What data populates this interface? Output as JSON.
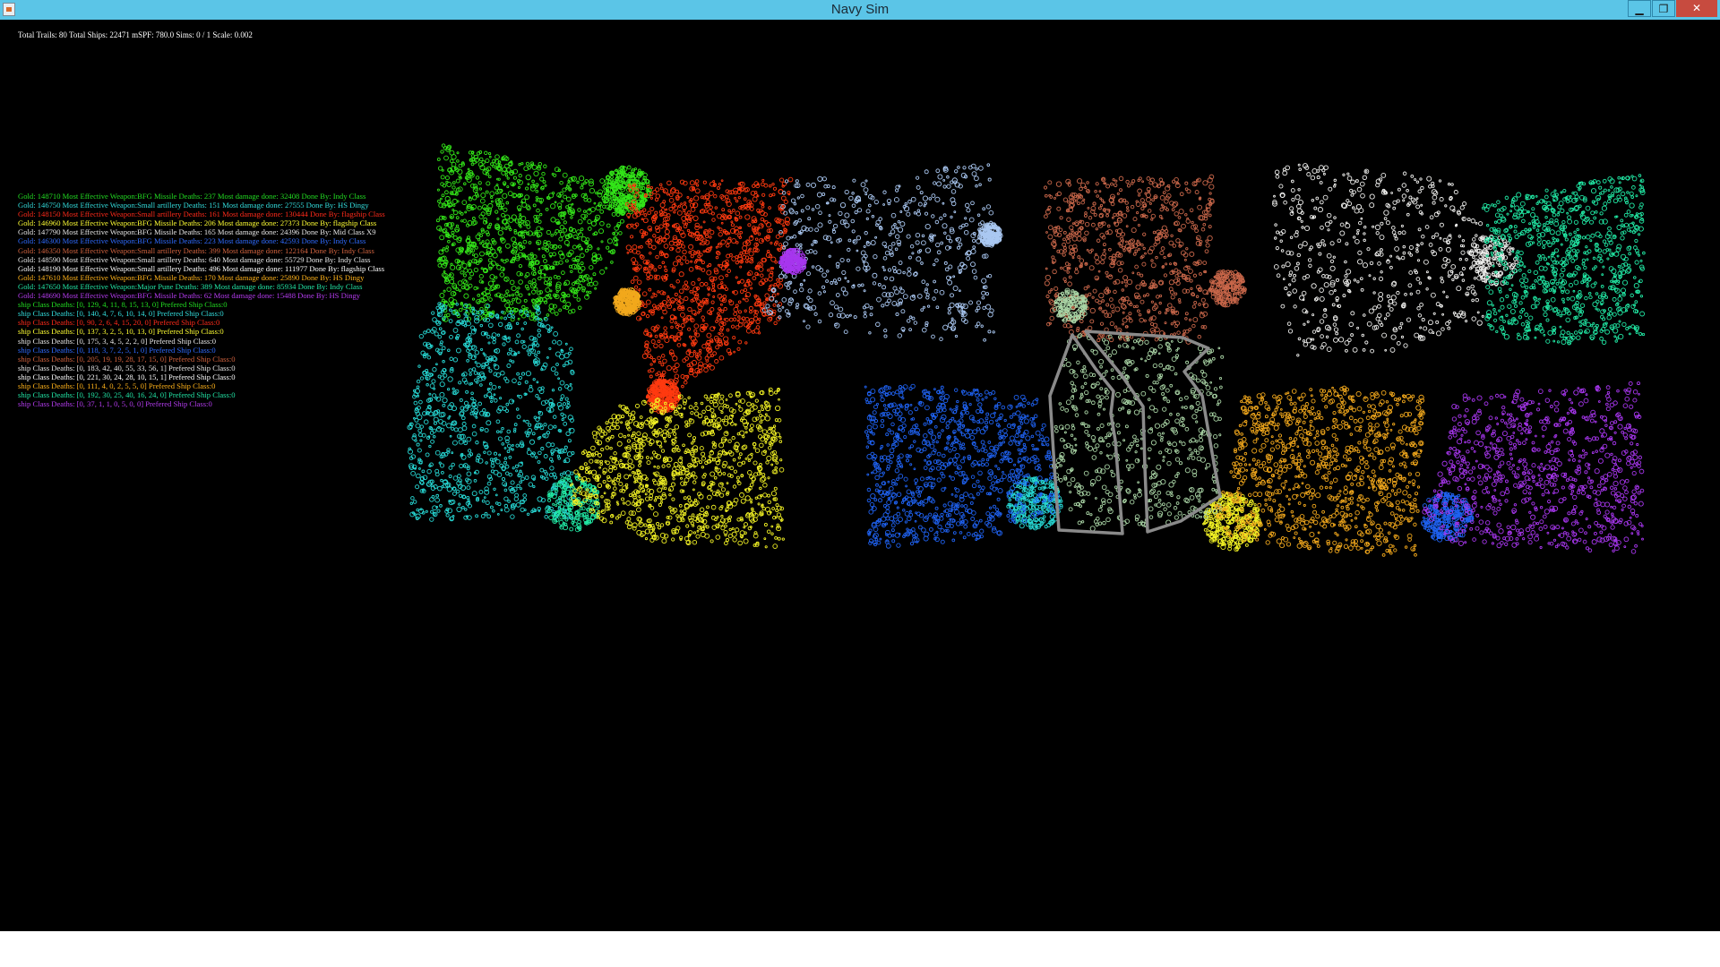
{
  "window": {
    "title": "Navy Sim",
    "buttons": {
      "minimize": "▁",
      "maximize": "❐",
      "close": "✕"
    },
    "icon": "java-app-icon"
  },
  "hud": {
    "stats": "Total Trails: 80 Total Ships: 22471 mSPF: 780.0 Sims: 0 / 1 Scale: 0.002"
  },
  "teams": [
    {
      "color": "#22dd22",
      "summary": "Gold: 148710  Most Effective Weapon:BFG Missile  Deaths: 237  Most damage done: 32408  Done By: Indy Class",
      "class_deaths": "ship Class Deaths: [0, 129, 4, 11, 8, 15, 13, 0] Prefered Ship Class:0"
    },
    {
      "color": "#33dddd",
      "summary": "Gold: 146750  Most Effective Weapon:Small artillery  Deaths: 151  Most damage done: 27555  Done By: HS Dingy",
      "class_deaths": "ship Class Deaths: [0, 140, 4, 7, 6, 10, 14, 0] Prefered Ship Class:0"
    },
    {
      "color": "#ff2a1a",
      "summary": "Gold: 148150  Most Effective Weapon:Small artillery  Deaths: 161  Most damage done: 130444  Done By: flagship Class",
      "class_deaths": "ship Class Deaths: [0, 90, 2, 6, 4, 15, 20, 0] Prefered Ship Class:0"
    },
    {
      "color": "#ffff33",
      "summary": "Gold: 146960  Most Effective Weapon:BFG Missile  Deaths: 206  Most damage done: 27373  Done By: flagship Class",
      "class_deaths": "ship Class Deaths: [0, 137, 3, 2, 5, 10, 13, 0] Prefered Ship Class:0"
    },
    {
      "color": "#e6e6e6",
      "summary": "Gold: 147790  Most Effective Weapon:BFG Missile  Deaths: 165  Most damage done: 24396  Done By: Mid Class X9",
      "class_deaths": "ship Class Deaths: [0, 175, 3, 4, 5, 2, 2, 0] Prefered Ship Class:0"
    },
    {
      "color": "#2f6bff",
      "summary": "Gold: 146300  Most Effective Weapon:BFG Missile  Deaths: 223  Most damage done: 42593  Done By: Indy Class",
      "class_deaths": "ship Class Deaths: [0, 118, 3, 7, 2, 5, 1, 0] Prefered Ship Class:0"
    },
    {
      "color": "#d2633f",
      "summary": "Gold: 146350  Most Effective Weapon:Small artillery  Deaths: 399  Most damage done: 122164  Done By: Indy Class",
      "class_deaths": "ship Class Deaths: [0, 205, 19, 19, 28, 17, 15, 0] Prefered Ship Class:0"
    },
    {
      "color": "#e8e8e8",
      "summary": "Gold: 148590  Most Effective Weapon:Small artillery  Deaths: 640  Most damage done: 55729  Done By: Indy Class",
      "class_deaths": "ship Class Deaths: [0, 183, 42, 40, 55, 33, 56, 1] Prefered Ship Class:0"
    },
    {
      "color": "#ffffff",
      "summary": "Gold: 148190  Most Effective Weapon:Small artillery  Deaths: 496  Most damage done: 111977  Done By: flagship Class",
      "class_deaths": "ship Class Deaths: [0, 221, 30, 24, 28, 10, 15, 1] Prefered Ship Class:0"
    },
    {
      "color": "#ffb21a",
      "summary": "Gold: 147610  Most Effective Weapon:BFG Missile  Deaths: 170  Most damage done: 25890  Done By: HS Dingy",
      "class_deaths": "ship Class Deaths: [0, 111, 4, 0, 2, 5, 5, 0] Prefered Ship Class:0"
    },
    {
      "color": "#22e6a6",
      "summary": "Gold: 147650  Most Effective Weapon:Major Pune  Deaths: 389  Most damage done: 85934  Done By: Indy Class",
      "class_deaths": "ship Class Deaths: [0, 192, 30, 25, 40, 16, 24, 0] Prefered Ship Class:0"
    },
    {
      "color": "#b53cf0",
      "summary": "Gold: 148690  Most Effective Weapon:BFG Missile  Deaths: 62  Most damage done: 15488  Done By: HS Dingy",
      "class_deaths": "ship Class Deaths: [0, 37, 1, 1, 0, 5, 0, 0] Prefered Ship Class:0"
    }
  ],
  "fleets": [
    {
      "color": "#33e619",
      "count": 1300
    },
    {
      "color": "#ff3a10",
      "count": 1300
    },
    {
      "color": "#aac8f2",
      "count": 700
    },
    {
      "color": "#c9674a",
      "count": 900
    },
    {
      "color": "#f0f0ee",
      "count": 650
    },
    {
      "color": "#21e8a4",
      "count": 1000
    },
    {
      "color": "#27d8d4",
      "count": 1100
    },
    {
      "color": "#f0f024",
      "count": 1300
    },
    {
      "color": "#1f62f2",
      "count": 1100
    },
    {
      "color": "#a9d4a5",
      "count": 700
    },
    {
      "color": "#f2a81c",
      "count": 1200
    },
    {
      "color": "#a736ee",
      "count": 1000
    }
  ],
  "overlay_outline_color": "#8a8a8a"
}
